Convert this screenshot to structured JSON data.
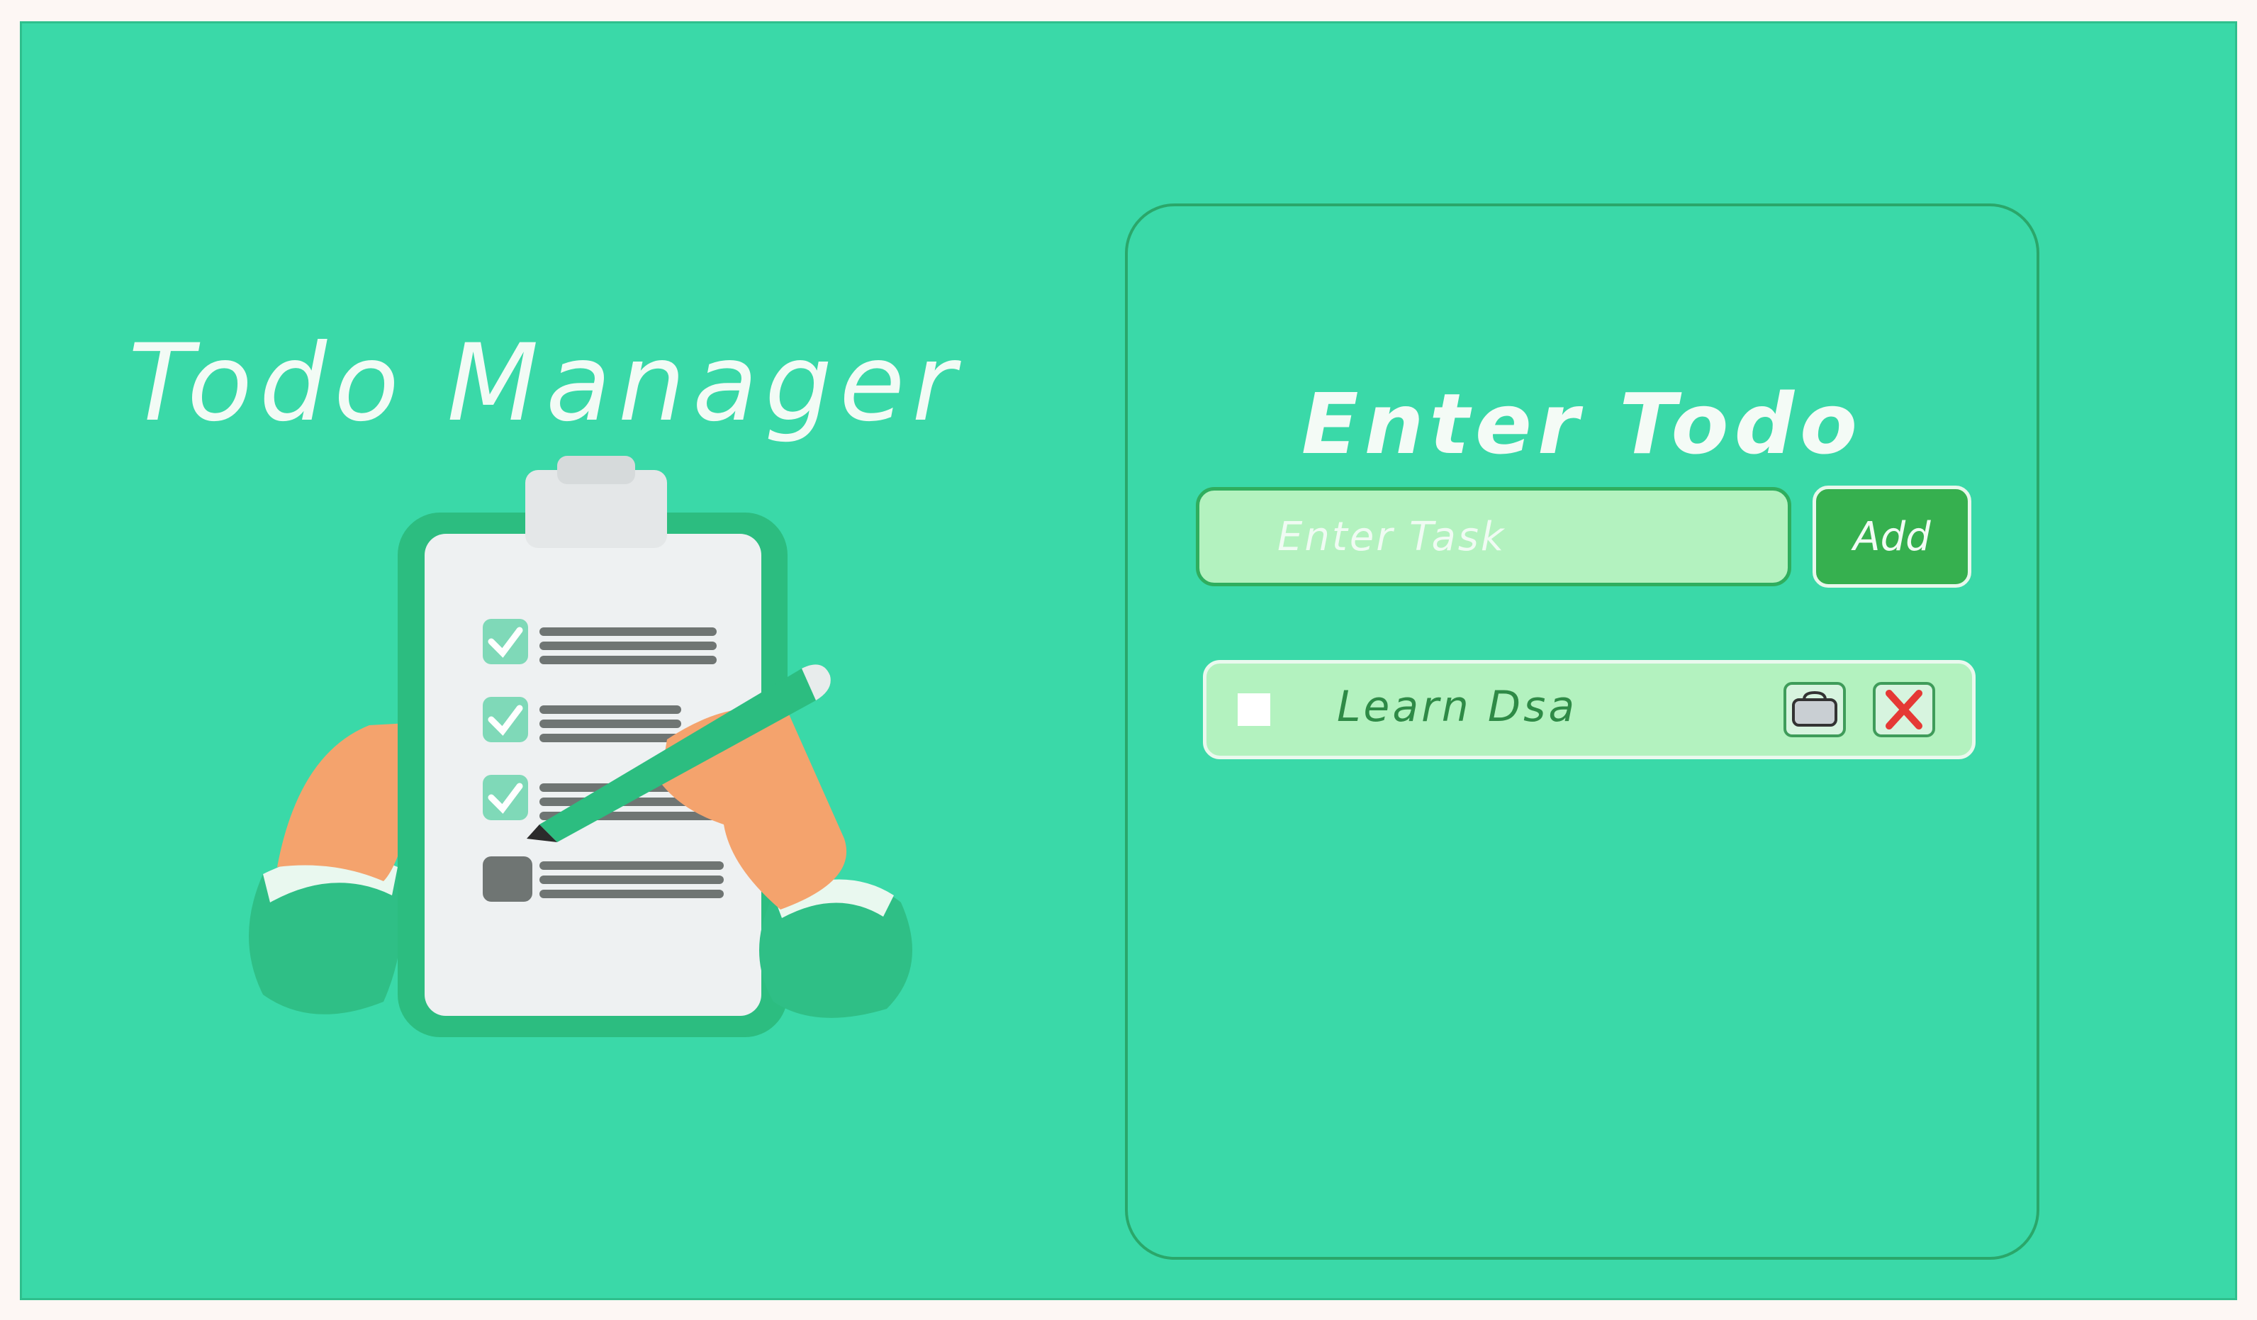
{
  "app": {
    "title": "Todo Manager"
  },
  "panel": {
    "title": "Enter Todo",
    "input_placeholder": "Enter Task",
    "input_value": "",
    "add_label": "Add"
  },
  "todos": [
    {
      "text": "Learn Dsa",
      "done": false
    }
  ],
  "icons": {
    "illustration": "clipboard-checklist-illustration",
    "edit": "toolbox-edit-icon",
    "delete": "red-x-delete-icon"
  },
  "colors": {
    "background": "#3ad9a8",
    "panel_border": "#2aa76a",
    "input_fill": "#b3f2bf",
    "button_fill": "#36b04f",
    "text_light": "#f2fbf5",
    "todo_text": "#2e8a46",
    "delete_red": "#e53935"
  }
}
